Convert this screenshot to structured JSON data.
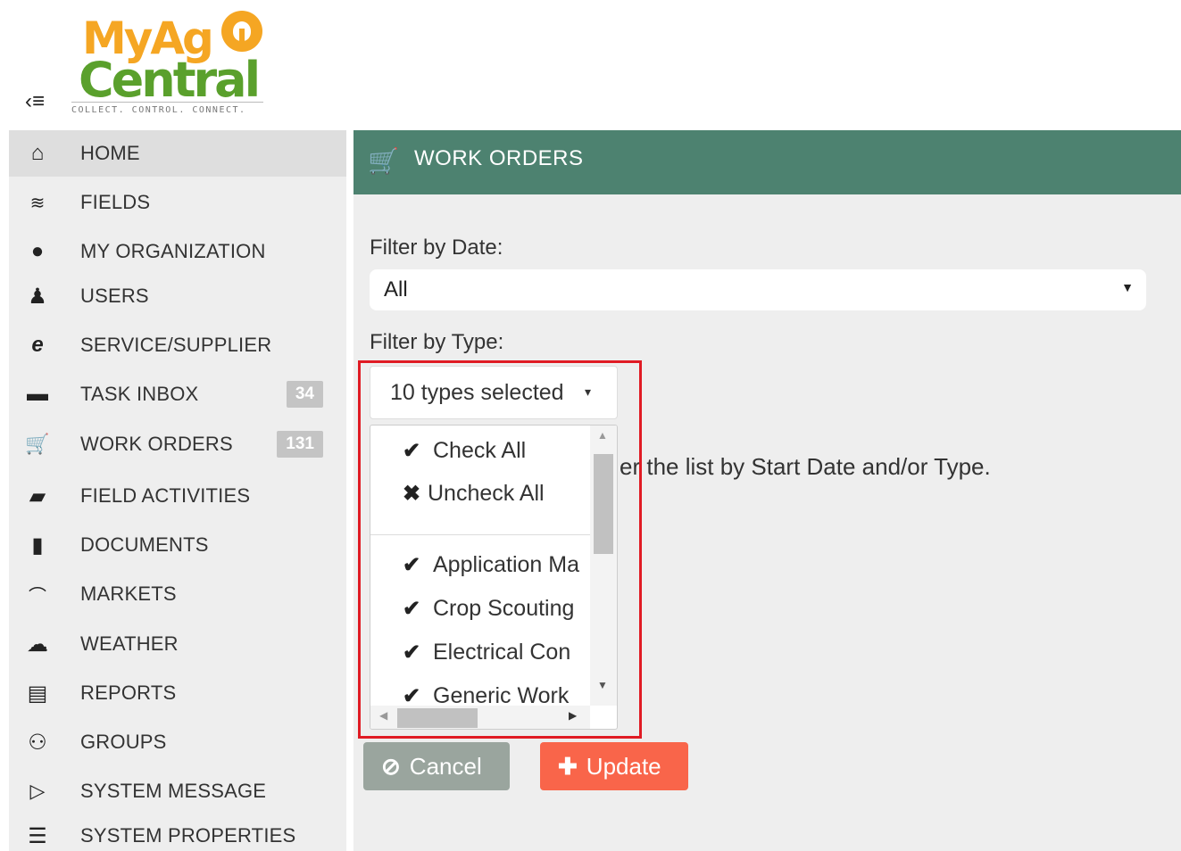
{
  "header": {
    "logo_line1": "MyAg",
    "logo_line2": "Central",
    "logo_tagline": "COLLECT. CONTROL. CONNECT.",
    "menu_icon": "collapse-menu-icon"
  },
  "sidebar": {
    "items": [
      {
        "label": "HOME",
        "icon": "home-icon",
        "glyph": "⌂",
        "active": true
      },
      {
        "label": "FIELDS",
        "icon": "fields-icon",
        "glyph": "≋"
      },
      {
        "label": "MY ORGANIZATION",
        "icon": "globe-icon",
        "glyph": "●"
      },
      {
        "label": "USERS",
        "icon": "user-icon",
        "glyph": "♟"
      },
      {
        "label": "SERVICE/SUPPLIER",
        "icon": "service-icon",
        "glyph": "e"
      },
      {
        "label": "TASK INBOX",
        "icon": "inbox-icon",
        "glyph": "▬",
        "badge": "34"
      },
      {
        "label": "WORK ORDERS",
        "icon": "cart-icon",
        "glyph": "🛒",
        "badge": "131"
      },
      {
        "label": "FIELD ACTIVITIES",
        "icon": "tractor-icon",
        "glyph": "▰"
      },
      {
        "label": "DOCUMENTS",
        "icon": "documents-icon",
        "glyph": "▮"
      },
      {
        "label": "MARKETS",
        "icon": "chart-icon",
        "glyph": "📈"
      },
      {
        "label": "WEATHER",
        "icon": "cloud-icon",
        "glyph": "☁"
      },
      {
        "label": "REPORTS",
        "icon": "report-icon",
        "glyph": "▤"
      },
      {
        "label": "GROUPS",
        "icon": "groups-icon",
        "glyph": "⚇"
      },
      {
        "label": "SYSTEM MESSAGE",
        "icon": "megaphone-icon",
        "glyph": "📢"
      },
      {
        "label": "SYSTEM PROPERTIES",
        "icon": "list-icon",
        "glyph": "☰"
      }
    ]
  },
  "main": {
    "title": "WORK ORDERS",
    "title_icon": "cart-icon",
    "filter_date_label": "Filter by Date:",
    "filter_date_value": "All",
    "filter_type_label": "Filter by Type:",
    "filter_type_value": "10 types selected",
    "dropdown": {
      "check_all": "Check All",
      "uncheck_all": "Uncheck All",
      "options": [
        "Application Ma",
        "Crop Scouting",
        "Electrical Con",
        "Generic Work"
      ]
    },
    "hint_text": "er the list by Start Date and/or Type.",
    "cancel_label": "Cancel",
    "update_label": "Update"
  },
  "colors": {
    "header_bar": "#4d8270",
    "update_button": "#f9654a",
    "cancel_button": "#9aa59e",
    "highlight_border": "#e01b24",
    "logo_orange": "#f5a623",
    "logo_green": "#5aa02c"
  }
}
